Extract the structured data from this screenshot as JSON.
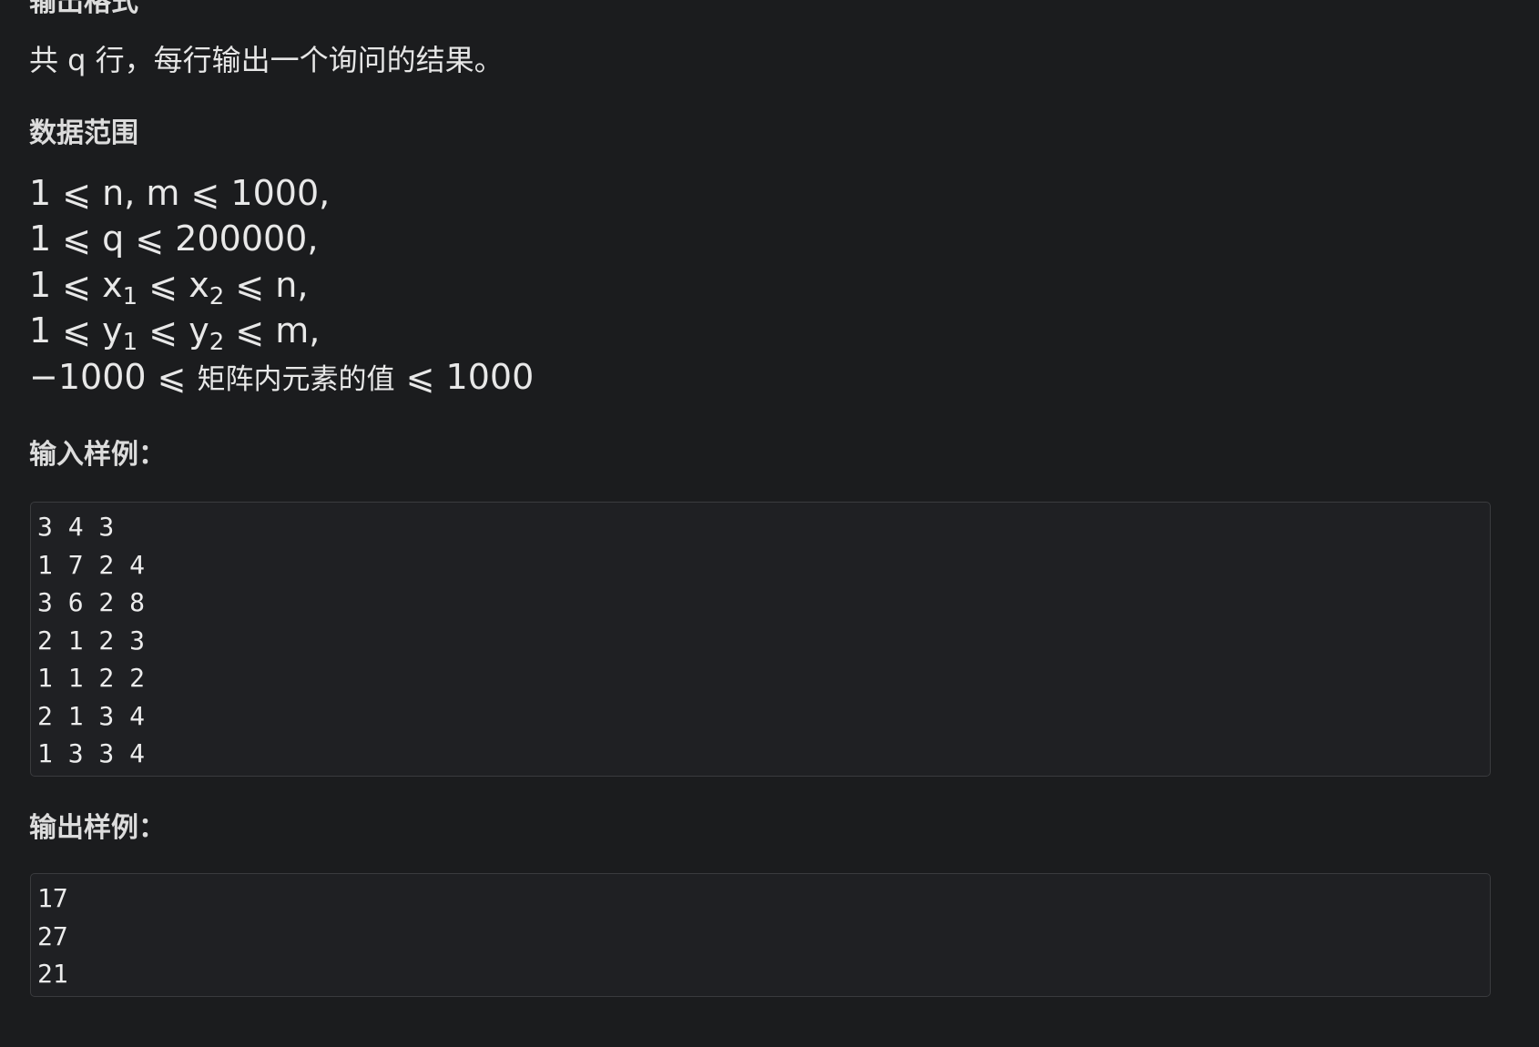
{
  "output_format": {
    "title": "输出格式",
    "text": "共 q 行，每行输出一个询问的结果。"
  },
  "data_range": {
    "title": "数据范围",
    "line1": "1 ⩽ n, m ⩽ 1000,",
    "line2": "1 ⩽ q ⩽ 200000,",
    "line3": {
      "a": "1 ⩽ x",
      "sub1": "1",
      "b": " ⩽ x",
      "sub2": "2",
      "c": " ⩽ n,"
    },
    "line4": {
      "a": "1 ⩽ y",
      "sub1": "1",
      "b": " ⩽ y",
      "sub2": "2",
      "c": " ⩽ m,"
    },
    "line5": {
      "a": "−1000 ⩽ ",
      "cjk": "矩阵内元素的值",
      "c": " ⩽ 1000"
    }
  },
  "sample_input": {
    "title": "输入样例：",
    "lines": [
      "3 4 3",
      "1 7 2 4",
      "3 6 2 8",
      "2 1 2 3",
      "1 1 2 2",
      "2 1 3 4",
      "1 3 3 4"
    ]
  },
  "sample_output": {
    "title": "输出样例：",
    "lines": [
      "17",
      "27",
      "21"
    ]
  }
}
